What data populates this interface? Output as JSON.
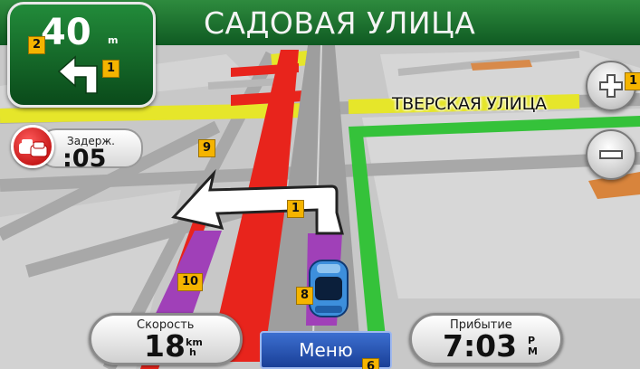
{
  "banner": {
    "street_name": "САДОВАЯ УЛИЦА"
  },
  "turn": {
    "distance": "40",
    "unit": "m",
    "direction": "left"
  },
  "delay": {
    "label": "Задерж.",
    "value": ":05",
    "icon": "traffic-cars-icon"
  },
  "map": {
    "cross_street": "ТВЕРСКАЯ УЛИЦА",
    "vehicle_icon": "car-icon"
  },
  "zoom": {
    "in_icon": "plus-icon",
    "out_icon": "minus-icon"
  },
  "speed": {
    "label": "Скорость",
    "value": "18",
    "unit_top": "km",
    "unit_bottom": "h"
  },
  "arrival": {
    "label": "Прибытие",
    "value": "7:03",
    "unit_top": "P",
    "unit_bottom": "M"
  },
  "menu": {
    "label": "Меню"
  },
  "markers": {
    "m1": "1",
    "m2": "2",
    "m3": "1",
    "m4": "1",
    "m5": "9",
    "m6": "10",
    "m7": "8",
    "m8": "6"
  },
  "colors": {
    "banner": "#0f5a22",
    "traffic_heavy": "#e8241c",
    "traffic_moderate": "#e6e62a",
    "traffic_free": "#35c23a",
    "route": "#a040b8",
    "menu": "#1a3f97"
  }
}
